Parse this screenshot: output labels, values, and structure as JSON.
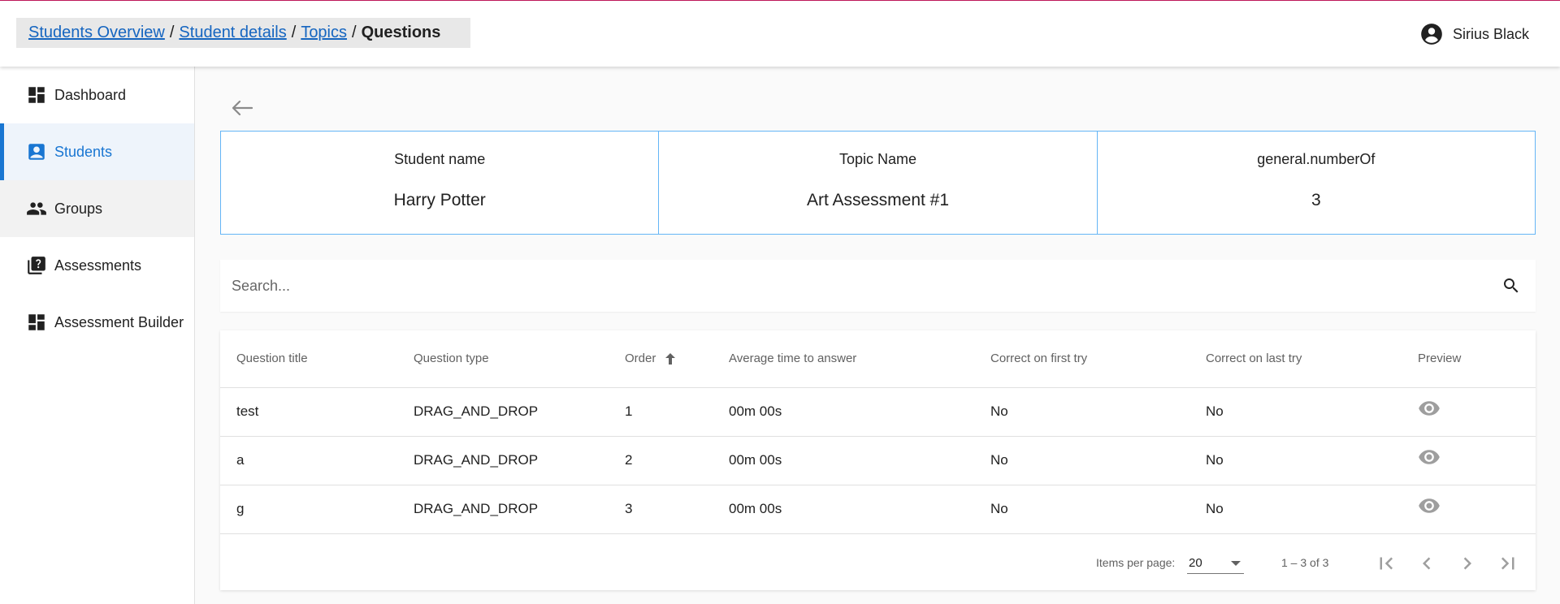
{
  "header": {
    "breadcrumb": [
      {
        "label": "Students Overview"
      },
      {
        "label": "Student details"
      },
      {
        "label": "Topics"
      }
    ],
    "breadcrumb_separator": "/",
    "breadcrumb_current": "Questions",
    "user_name": "Sirius Black"
  },
  "sidebar": {
    "items": [
      {
        "label": "Dashboard",
        "icon": "dashboard-icon"
      },
      {
        "label": "Students",
        "icon": "student-badge-icon",
        "active": true
      },
      {
        "label": "Groups",
        "icon": "groups-icon"
      },
      {
        "label": "Assessments",
        "icon": "quiz-icon"
      },
      {
        "label": "Assessment Builder",
        "icon": "dashboard-icon"
      }
    ]
  },
  "info": {
    "student_label": "Student name",
    "student_value": "Harry Potter",
    "topic_label": "Topic Name",
    "topic_value": "Art Assessment #1",
    "count_label": "general.numberOf",
    "count_value": "3"
  },
  "search": {
    "placeholder": "Search..."
  },
  "table": {
    "columns": [
      "Question title",
      "Question type",
      "Order",
      "Average time to answer",
      "Correct on first try",
      "Correct on last try",
      "Preview"
    ],
    "sorted_column": "Order",
    "sort_direction": "ascending",
    "rows": [
      {
        "title": "test",
        "type": "DRAG_AND_DROP",
        "order": "1",
        "avg_time": "00m 00s",
        "first_try": "No",
        "last_try": "No"
      },
      {
        "title": "a",
        "type": "DRAG_AND_DROP",
        "order": "2",
        "avg_time": "00m 00s",
        "first_try": "No",
        "last_try": "No"
      },
      {
        "title": "g",
        "type": "DRAG_AND_DROP",
        "order": "3",
        "avg_time": "00m 00s",
        "first_try": "No",
        "last_try": "No"
      }
    ]
  },
  "paginator": {
    "items_per_page_label": "Items per page:",
    "items_per_page_value": "20",
    "range_label": "1 – 3 of 3"
  },
  "colors": {
    "accent": "#1976d2",
    "link": "#1565c0",
    "info_border": "#64b5f6",
    "top_line": "#c2185b"
  }
}
